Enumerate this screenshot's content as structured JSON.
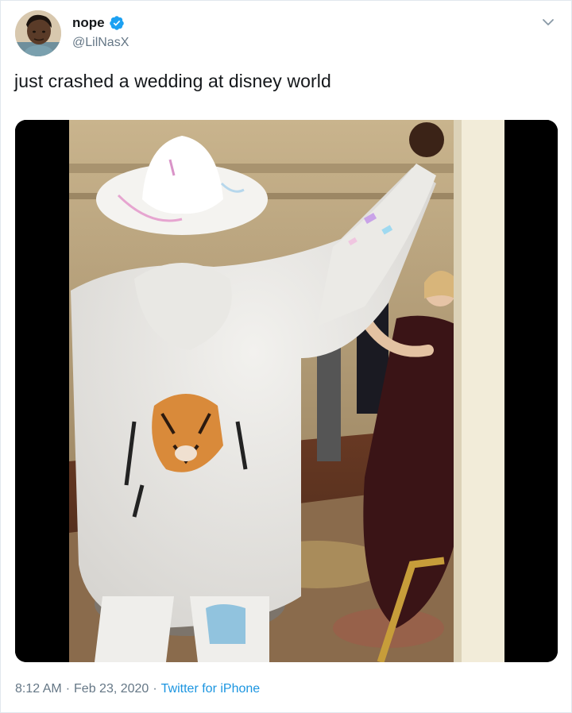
{
  "user": {
    "display_name": "nope",
    "handle": "@LilNasX",
    "verified_icon": "verified-badge-icon"
  },
  "tweet": {
    "text": "just crashed a wedding at disney world"
  },
  "media": {
    "type": "video"
  },
  "meta": {
    "time": "8:12 AM",
    "separator": "·",
    "date": "Feb 23, 2020",
    "source": "Twitter for iPhone"
  },
  "colors": {
    "link": "#1b95e0",
    "secondary_text": "#657786",
    "verified": "#1da1f2"
  }
}
